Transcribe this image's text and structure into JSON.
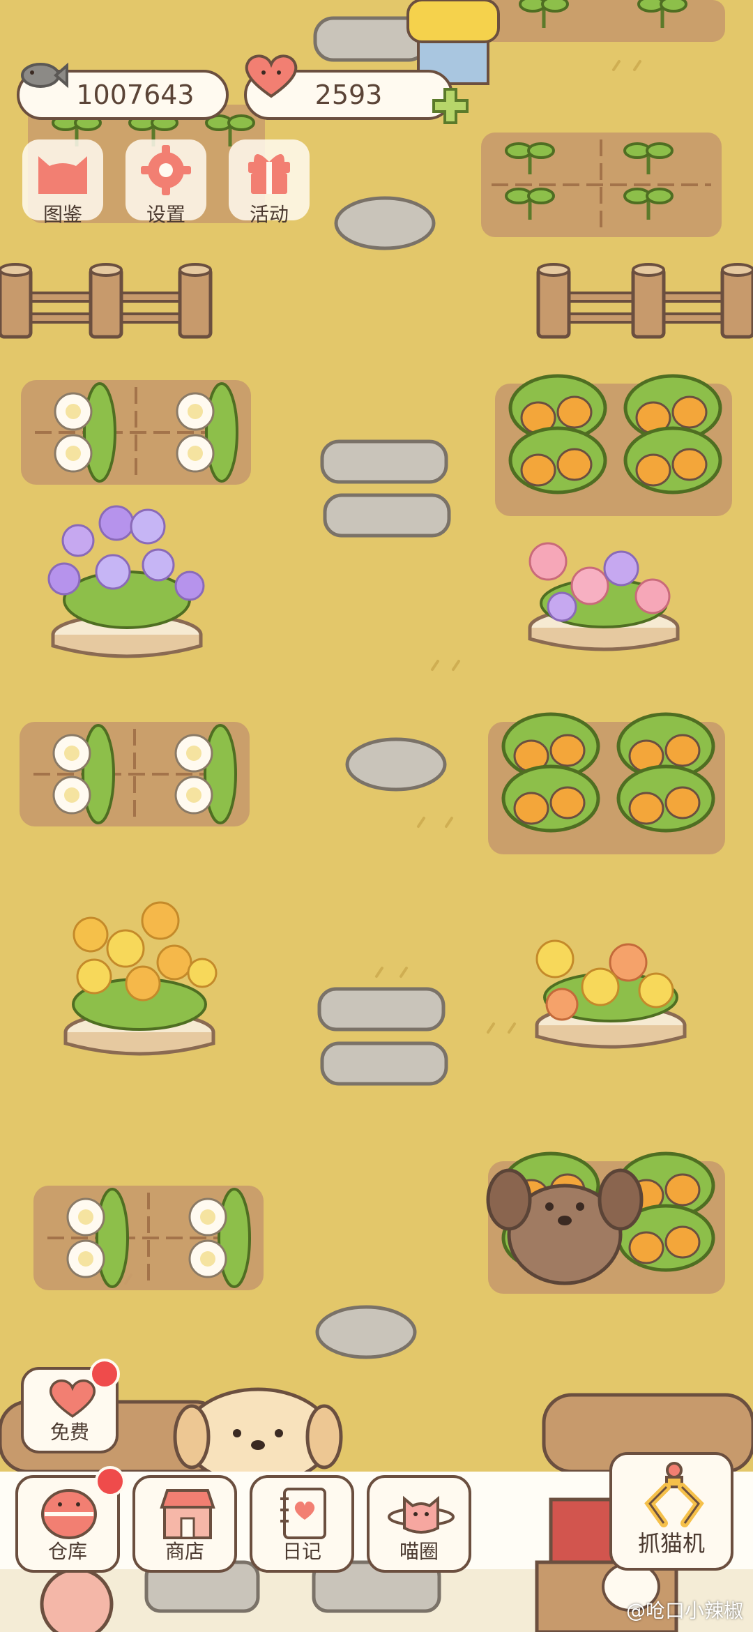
{
  "hud": {
    "fish_count": "1007643",
    "heart_count": "2593",
    "fish_icon": "fish-icon",
    "heart_icon": "heart-icon",
    "plus_icon": "plus-icon"
  },
  "top_menu": [
    {
      "label": "图鉴",
      "icon": "cat-face-icon"
    },
    {
      "label": "设置",
      "icon": "gear-icon"
    },
    {
      "label": "活动",
      "icon": "gift-icon"
    }
  ],
  "side_button": {
    "label": "免费",
    "icon": "heart-icon",
    "has_badge": true
  },
  "dock": [
    {
      "label": "仓库",
      "icon": "basket-icon",
      "has_badge": true
    },
    {
      "label": "商店",
      "icon": "shop-icon",
      "has_badge": false
    },
    {
      "label": "日记",
      "icon": "diary-icon",
      "has_badge": false
    },
    {
      "label": "喵圈",
      "icon": "cat-planet-icon",
      "has_badge": false
    }
  ],
  "claw_machine": {
    "label": "抓猫机",
    "icon": "claw-icon"
  },
  "watermark": "@呛口小辣椒",
  "colors": {
    "ground": "#e3c76a",
    "soil": "#c79a6c",
    "outline": "#6b4f3f",
    "card": "#fffaf0",
    "accent_pink": "#f27f72",
    "badge_red": "#ef4b4b",
    "leaf": "#8dbf4a"
  }
}
